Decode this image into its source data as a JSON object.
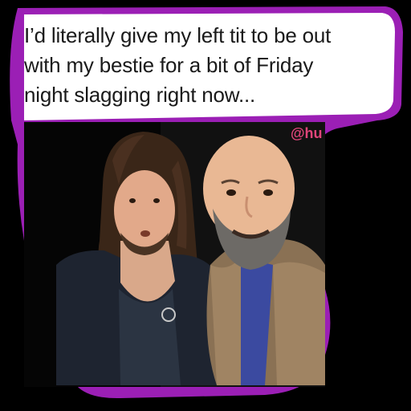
{
  "caption": {
    "lines": [
      "I’d literally give my left tit to be out",
      "with my bestie for a bit of Friday",
      "night slagging right now..."
    ]
  },
  "watermark": {
    "handle": "@hu"
  },
  "colors": {
    "sticker_border": "#9b1fb5",
    "caption_background": "#ffffff",
    "photo_background": "#000000",
    "caption_text": "#1a1a1a",
    "handle_text": "#e0457a"
  }
}
